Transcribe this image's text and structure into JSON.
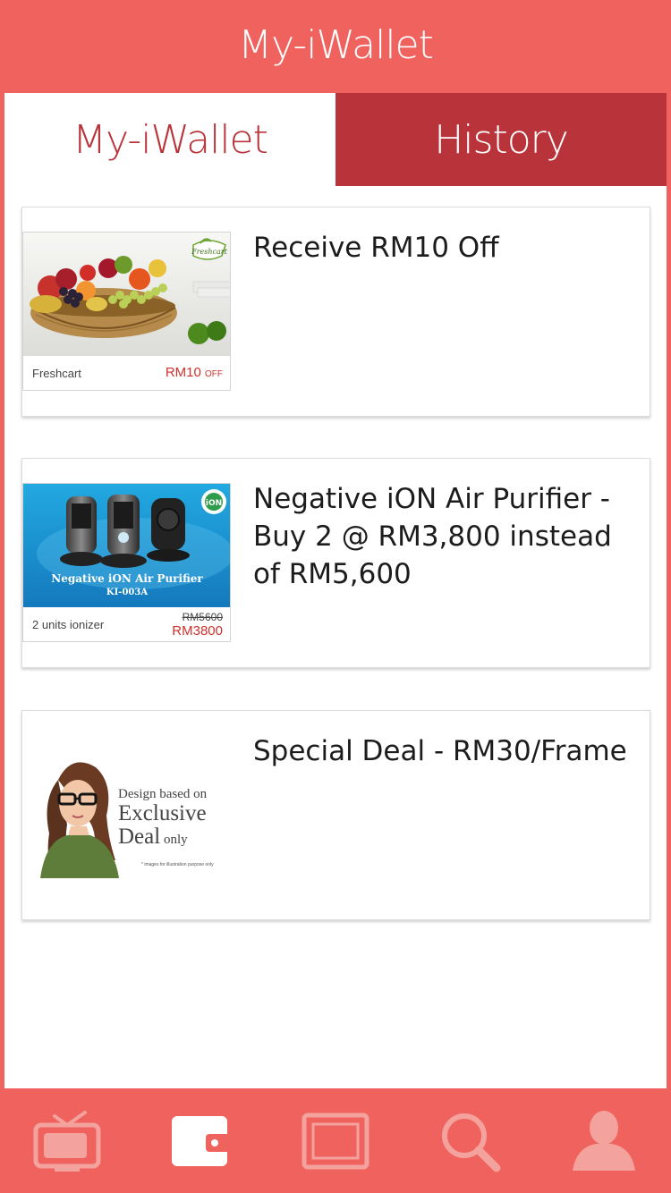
{
  "header": {
    "title": "My-iWallet"
  },
  "tabs": [
    {
      "label": "My-iWallet",
      "active": true
    },
    {
      "label": "History",
      "active": false
    }
  ],
  "deals": [
    {
      "title": "Receive RM10 Off",
      "thumb": {
        "name": "Freshcart",
        "price": "RM10",
        "price_suffix": "OFF",
        "brand": "Freshcart"
      }
    },
    {
      "title": "Negative iON Air Purifier - Buy 2 @ RM3,800 instead of RM5,600",
      "thumb": {
        "name": "2 units ionizer",
        "old_price": "RM5600",
        "new_price": "RM3800",
        "product": "Negative iON Air Purifier",
        "model": "KI-003A",
        "badge": "iON"
      }
    },
    {
      "title": "Special Deal - RM30/Frame",
      "thumb": {
        "line1": "Design based on",
        "line2": "Exclusive",
        "line3": "Deal",
        "line3b": "only",
        "note": "* images for illustration purpose only"
      }
    }
  ],
  "bottom_nav": [
    {
      "icon": "tv-icon"
    },
    {
      "icon": "wallet-icon",
      "active": true
    },
    {
      "icon": "frame-icon"
    },
    {
      "icon": "search-icon"
    },
    {
      "icon": "user-icon"
    }
  ],
  "colors": {
    "primary": "#f0625e",
    "dark_red": "#b8343a",
    "accent_red": "#d0312d"
  }
}
